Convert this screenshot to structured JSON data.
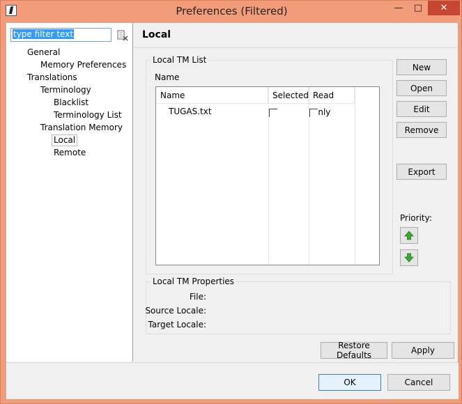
{
  "window": {
    "title": "Preferences (Filtered)",
    "minimize_glyph": "—",
    "maximize_glyph": "□",
    "close_glyph": "✕"
  },
  "filter": {
    "value": "type filter text"
  },
  "tree": {
    "items": [
      {
        "label": "General"
      },
      {
        "label": "Memory Preferences"
      },
      {
        "label": "Translations"
      },
      {
        "label": "Terminology"
      },
      {
        "label": "Blacklist"
      },
      {
        "label": "Terminology List"
      },
      {
        "label": "Translation Memory"
      },
      {
        "label": "Local"
      },
      {
        "label": "Remote"
      }
    ]
  },
  "page": {
    "title": "Local",
    "list_group_label": "Local TM List",
    "name_caption": "Name",
    "table": {
      "columns": [
        "Name",
        "Selected",
        "Read only"
      ],
      "rows": [
        {
          "name": "TUGAS.txt",
          "selected": false,
          "read_only": false
        }
      ]
    },
    "buttons": {
      "new": "New",
      "open": "Open",
      "edit": "Edit",
      "remove": "Remove",
      "export": "Export"
    },
    "priority_label": "Priority:",
    "properties_group_label": "Local TM Properties",
    "properties": {
      "file_label": "File:",
      "source_locale_label": "Source Locale:",
      "target_locale_label": "Target Locale:"
    },
    "restore_defaults": "Restore Defaults",
    "apply": "Apply"
  },
  "dialog": {
    "ok": "OK",
    "cancel": "Cancel"
  },
  "colors": {
    "titlebar": "#f29c7a",
    "close_button": "#c7462f",
    "selection": "#3399ff",
    "arrow_green": "#3aa832"
  }
}
